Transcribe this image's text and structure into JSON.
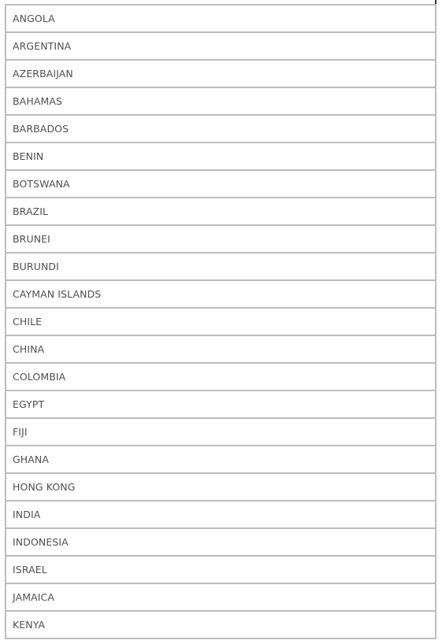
{
  "countries": [
    "ANGOLA",
    "ARGENTINA",
    "AZERBAIJAN",
    "BAHAMAS",
    "BARBADOS",
    "BENIN",
    "BOTSWANA",
    "BRAZIL",
    "BRUNEI",
    "BURUNDI",
    "CAYMAN ISLANDS",
    "CHILE",
    "CHINA",
    "COLOMBIA",
    "EGYPT",
    "FIJI",
    "GHANA",
    "HONG KONG",
    "INDIA",
    "INDONESIA",
    "ISRAEL",
    "JAMAICA",
    "KENYA"
  ],
  "colors": {
    "border": "#bdbdbd",
    "text": "#505050"
  }
}
